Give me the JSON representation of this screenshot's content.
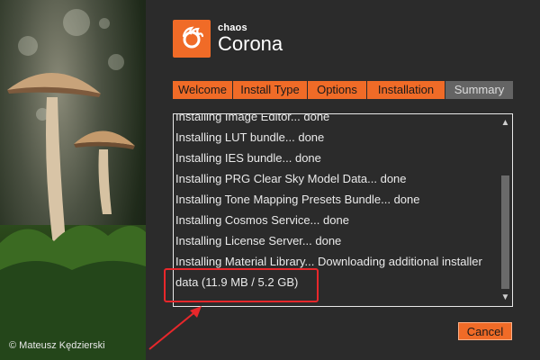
{
  "hero": {
    "credit": "© Mateusz Kędzierski"
  },
  "logo": {
    "brand": "chaos",
    "product": "Corona",
    "icon": "corona-flame-icon"
  },
  "tabs": [
    {
      "label": "Welcome",
      "active": true
    },
    {
      "label": "Install Type",
      "active": true
    },
    {
      "label": "Options",
      "active": true
    },
    {
      "label": "Installation",
      "active": true
    },
    {
      "label": "Summary",
      "active": false
    }
  ],
  "log": {
    "lines": [
      "Installing Image Editor... done",
      "Installing LUT bundle... done",
      "Installing IES bundle... done",
      "Installing PRG Clear Sky Model Data... done",
      "Installing Tone Mapping Presets Bundle... done",
      "Installing Cosmos Service... done",
      "Installing License Server... done",
      "Installing Material Library... Downloading additional installer",
      "data (11.9 MB / 5.2 GB)"
    ]
  },
  "buttons": {
    "cancel": "Cancel"
  },
  "colors": {
    "accent": "#f06b27",
    "highlight": "#e8272b",
    "background": "#2b2b2b"
  }
}
